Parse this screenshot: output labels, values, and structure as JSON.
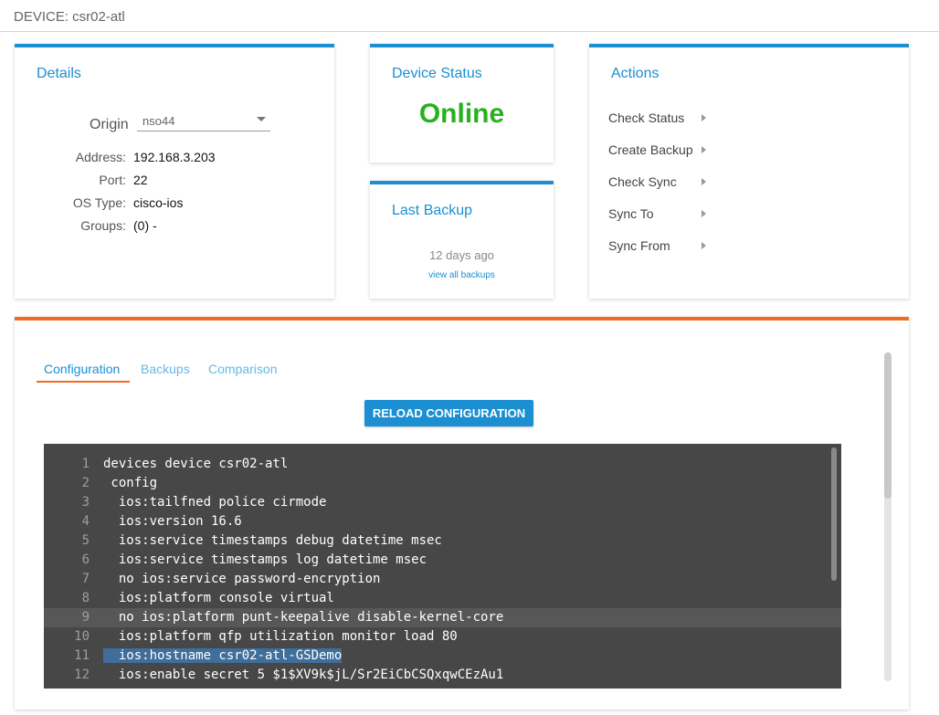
{
  "header": {
    "title": "DEVICE: csr02-atl"
  },
  "details": {
    "title": "Details",
    "origin_label": "Origin",
    "origin_value": "nso44",
    "rows": [
      {
        "key": "Address:",
        "value": "192.168.3.203"
      },
      {
        "key": "Port:",
        "value": "22"
      },
      {
        "key": "OS Type:",
        "value": "cisco-ios"
      },
      {
        "key": "Groups:",
        "value": "(0) -"
      }
    ]
  },
  "device_status": {
    "title": "Device Status",
    "value": "Online",
    "color": "#27b11e"
  },
  "last_backup": {
    "title": "Last Backup",
    "ago": "12 days ago",
    "link": "view all backups"
  },
  "actions": {
    "title": "Actions",
    "items": [
      "Check Status",
      "Create Backup",
      "Check Sync",
      "Sync To",
      "Sync From"
    ]
  },
  "main": {
    "tabs": [
      {
        "label": "Configuration",
        "active": true
      },
      {
        "label": "Backups",
        "active": false
      },
      {
        "label": "Comparison",
        "active": false
      }
    ],
    "reload_button": "RELOAD CONFIGURATION",
    "config_lines": [
      {
        "n": "1",
        "text": "devices device csr02-atl"
      },
      {
        "n": "2",
        "text": " config"
      },
      {
        "n": "3",
        "text": "  ios:tailfned police cirmode"
      },
      {
        "n": "4",
        "text": "  ios:version 16.6"
      },
      {
        "n": "5",
        "text": "  ios:service timestamps debug datetime msec"
      },
      {
        "n": "6",
        "text": "  ios:service timestamps log datetime msec"
      },
      {
        "n": "7",
        "text": "  no ios:service password-encryption"
      },
      {
        "n": "8",
        "text": "  ios:platform console virtual"
      },
      {
        "n": "9",
        "text": "  no ios:platform punt-keepalive disable-kernel-core"
      },
      {
        "n": "10",
        "text": "  ios:platform qfp utilization monitor load 80"
      },
      {
        "n": "11",
        "text": "  ios:hostname csr02-atl-GSDemo"
      },
      {
        "n": "12",
        "text": "  ios:enable secret 5 $1$XV9k$jL/Sr2EiCbCSQxqwCEzAu1"
      }
    ],
    "highlighted_line": "9",
    "selected_line": "11"
  },
  "colors": {
    "accent": "#1b8fd2",
    "orange": "#f06a24",
    "editor_bg": "#474747"
  }
}
